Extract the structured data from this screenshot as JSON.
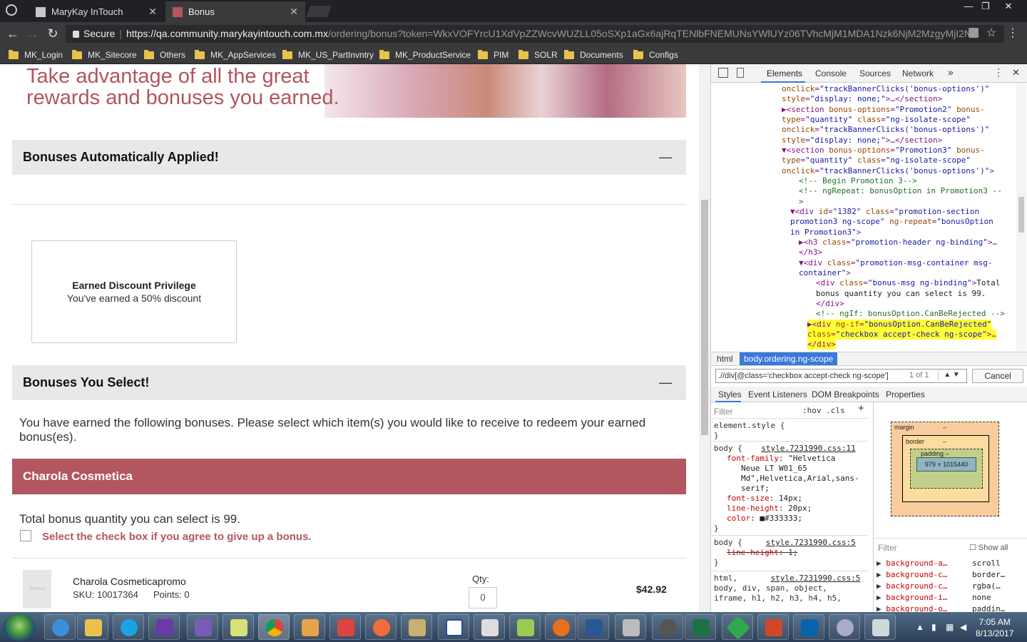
{
  "browser": {
    "tabs": [
      {
        "title": "MaryKay InTouch"
      },
      {
        "title": "Bonus"
      }
    ],
    "url": {
      "secure_label": "Secure",
      "host": "https://qa.community.marykayintouch.com.mx",
      "path": "/ordering/bonus?token=WkxVOFYrcU1XdVpZZWcvWUZLL05oSXp1aGx6ajRqTENlbFNEMUNsYWlUYz06TVhcMjM1MDA1Nzk6NjM2MzgyMjI2N..."
    },
    "bookmarks": [
      "MK_Login",
      "MK_Sitecore",
      "Others",
      "MK_AppServices",
      "MK_US_PartInvntry",
      "MK_ProductService",
      "PIM",
      "SOLR",
      "Documents",
      "Configs"
    ]
  },
  "page": {
    "banner_text": "Take advantage of all the great rewards and bonuses you earned.",
    "auto_section": {
      "title": "Bonuses Automatically Applied!",
      "collapse_symbol": "—"
    },
    "card": {
      "title": "Earned Discount Privilege",
      "text": "You've earned a 50% discount"
    },
    "select_section": {
      "title": "Bonuses You Select!",
      "collapse_symbol": "—"
    },
    "intro": "You have earned the following bonuses. Please select which item(s) you would like to receive to redeem your earned bonus(es).",
    "promo_title": "Charola Cosmetica",
    "total_qty": "Total bonus quantity you can select is 99.",
    "checkbox_label": "Select the check box if you agree to give up a bonus.",
    "product": {
      "image_alt": "Product",
      "name": "Charola Cosmeticapromo",
      "sku": "SKU: 10017364",
      "points": "Points: 0",
      "qty_label": "Qty:",
      "qty_value": "0",
      "price": "$42.92"
    }
  },
  "devtools": {
    "tabs": [
      "Elements",
      "Console",
      "Sources",
      "Network"
    ],
    "more": "»",
    "breadcrumb": [
      "html",
      "body.ordering.ng-scope"
    ],
    "search_query": ".//div[@class='checkbox accept-check ng-scope']",
    "search_count": "1 of 1",
    "cancel_label": "Cancel",
    "subtabs": [
      "Styles",
      "Event Listeners",
      "DOM Breakpoints",
      "Properties"
    ],
    "filter_placeholder": "Filter",
    "hov_cls": ":hov  .cls",
    "box_model": {
      "margin": "margin",
      "border": "border",
      "padding": "padding –",
      "content": "979 × 1015440",
      "dash": "–"
    },
    "show_all": "Show all",
    "computed": [
      {
        "prop": "background-a…",
        "val": "scroll"
      },
      {
        "prop": "background-c…",
        "val": "border…"
      },
      {
        "prop": "background-c…",
        "val": "rgba(…"
      },
      {
        "prop": "background-i…",
        "val": "none"
      },
      {
        "prop": "background-o…",
        "val": "paddin…"
      }
    ]
  },
  "taskbar": {
    "time": "7:05 AM",
    "date": "8/13/2017"
  }
}
